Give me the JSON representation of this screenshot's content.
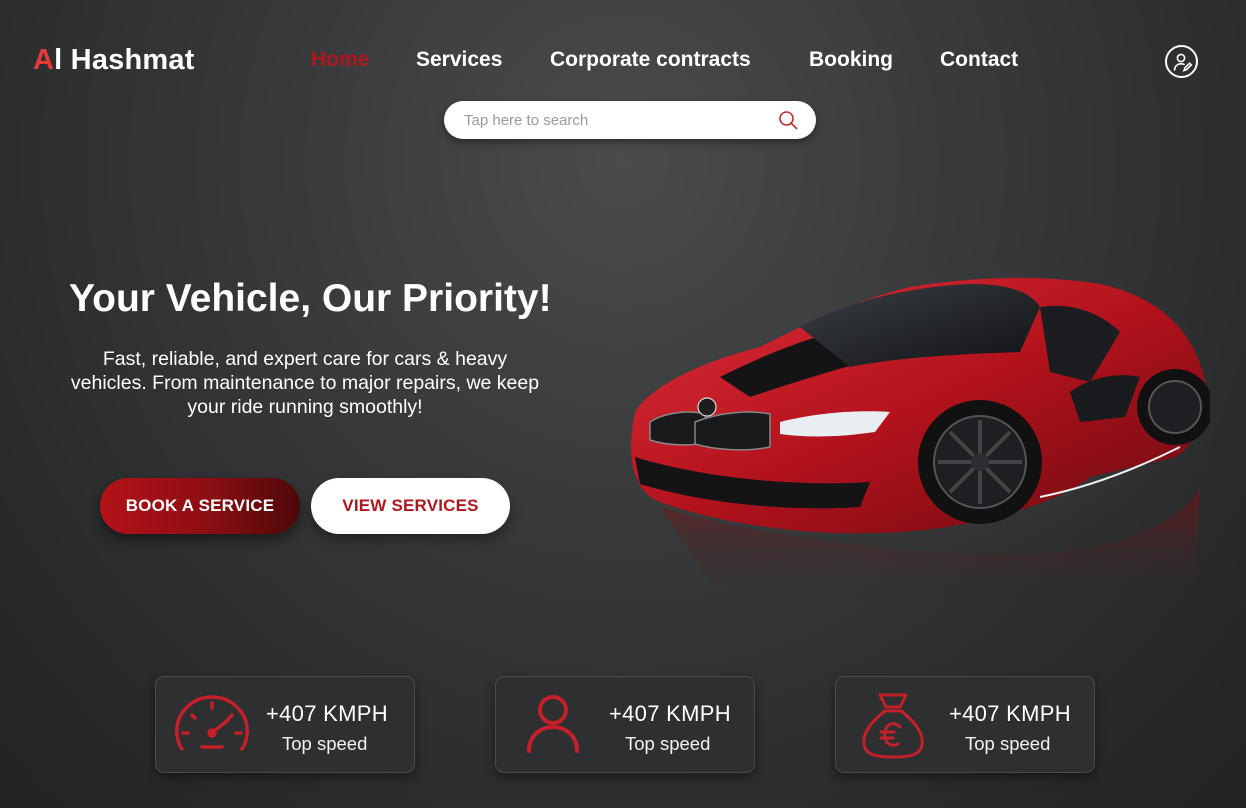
{
  "brand": {
    "accent_part": "A",
    "rest": "l Hashmat"
  },
  "nav": {
    "items": [
      {
        "label": "Home",
        "active": true
      },
      {
        "label": "Services",
        "active": false
      },
      {
        "label": "Corporate contracts",
        "active": false
      },
      {
        "label": "Booking",
        "active": false
      },
      {
        "label": "Contact",
        "active": false
      }
    ]
  },
  "search": {
    "placeholder": "Tap here to search",
    "value": ""
  },
  "hero": {
    "title": "Your Vehicle, Our Priority!",
    "subtitle": "Fast, reliable, and expert care for cars & heavy vehicles. From maintenance to major repairs, we keep your ride running smoothly!",
    "book_button": "BOOK A SERVICE",
    "view_button": "VIEW SERVICES"
  },
  "stats": [
    {
      "icon": "speedometer-icon",
      "value": "+407 KMPH",
      "label": "Top speed"
    },
    {
      "icon": "person-icon",
      "value": "+407 KMPH",
      "label": "Top speed"
    },
    {
      "icon": "money-bag-euro-icon",
      "value": "+407 KMPH",
      "label": "Top speed"
    }
  ],
  "colors": {
    "accent": "#e53935",
    "brand_red": "#b0171f",
    "background": "#3a3b3c",
    "card": "#2e2f30"
  }
}
